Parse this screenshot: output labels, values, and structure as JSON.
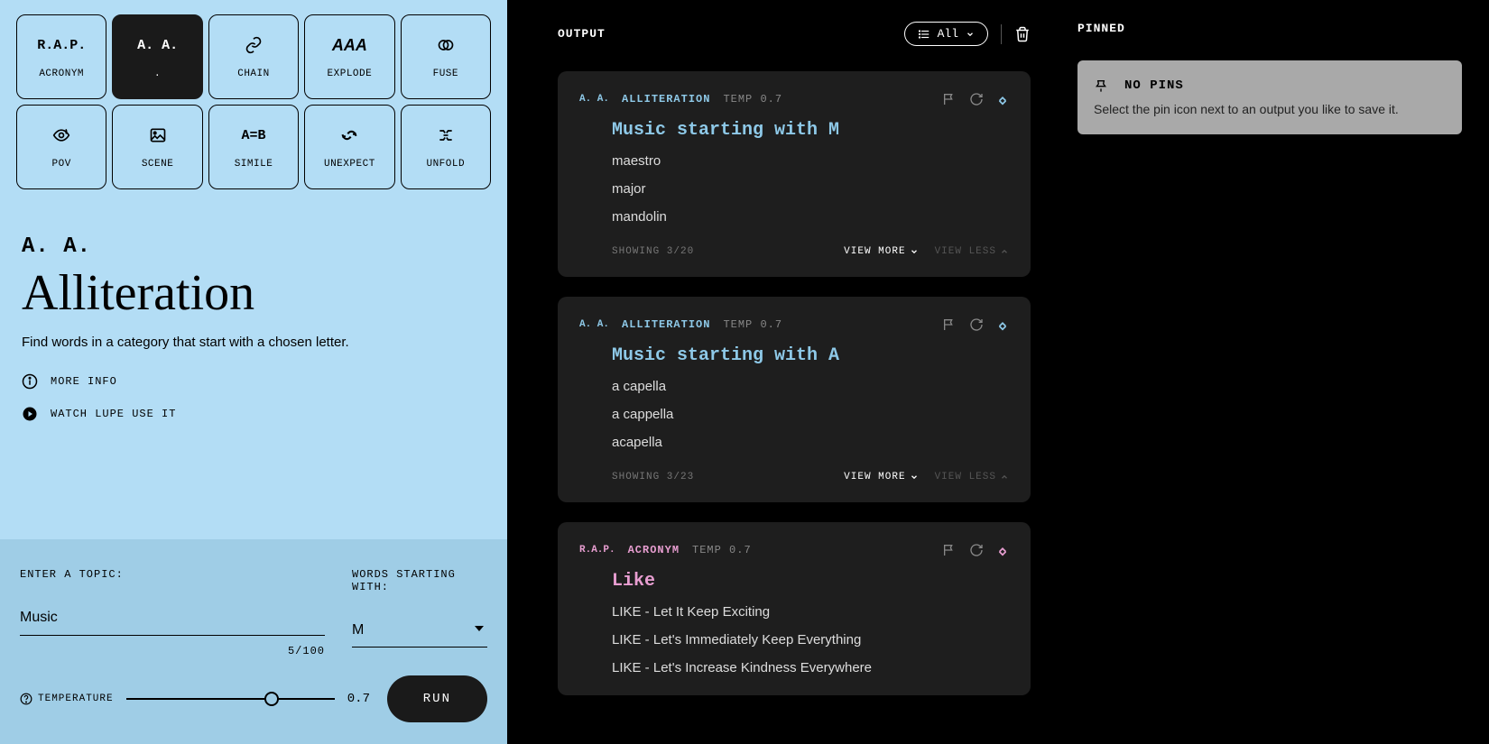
{
  "tools": [
    {
      "id": "acronym",
      "label": "ACRONYM",
      "icon": "R.A.P."
    },
    {
      "id": "alliteration",
      "label": ".",
      "icon": "A. A."
    },
    {
      "id": "chain",
      "label": "CHAIN",
      "icon": "chain"
    },
    {
      "id": "explode",
      "label": "EXPLODE",
      "icon": "explode"
    },
    {
      "id": "fuse",
      "label": "FUSE",
      "icon": "fuse"
    },
    {
      "id": "pov",
      "label": "POV",
      "icon": "pov"
    },
    {
      "id": "scene",
      "label": "SCENE",
      "icon": "scene"
    },
    {
      "id": "simile",
      "label": "SIMILE",
      "icon": "A=B"
    },
    {
      "id": "unexpect",
      "label": "UNEXPECT",
      "icon": "unexpect"
    },
    {
      "id": "unfold",
      "label": "UNFOLD",
      "icon": "unfold"
    }
  ],
  "active_tool": "alliteration",
  "hero": {
    "icon": "A. A.",
    "title": "Alliteration",
    "desc": "Find words in a category that start with a chosen letter.",
    "more_info": "MORE INFO",
    "watch": "WATCH LUPE USE IT"
  },
  "controls": {
    "topic_label": "ENTER A TOPIC:",
    "topic_value": "Music",
    "letter_label": "WORDS STARTING WITH:",
    "letter_value": "M",
    "charcount": "5/100",
    "temp_label": "TEMPERATURE",
    "temp_value": "0.7",
    "temp_pct": 70,
    "run": "RUN"
  },
  "output": {
    "title": "OUTPUT",
    "filter": "All",
    "cards": [
      {
        "icon": "A. A.",
        "tool": "ALLITERATION",
        "temp": "TEMP 0.7",
        "title": "Music starting with M",
        "items": [
          "maestro",
          "major",
          "mandolin"
        ],
        "showing": "SHOWING 3/20",
        "view_more": "VIEW MORE",
        "view_less": "VIEW LESS",
        "color": "blue"
      },
      {
        "icon": "A. A.",
        "tool": "ALLITERATION",
        "temp": "TEMP 0.7",
        "title": "Music starting with A",
        "items": [
          "a capella",
          "a cappella",
          "acapella"
        ],
        "showing": "SHOWING 3/23",
        "view_more": "VIEW MORE",
        "view_less": "VIEW LESS",
        "color": "blue"
      },
      {
        "icon": "R.A.P.",
        "tool": "ACRONYM",
        "temp": "TEMP 0.7",
        "title": "Like",
        "items": [
          "LIKE - Let It Keep Exciting",
          "LIKE - Let's Immediately Keep Everything",
          "LIKE - Let's Increase Kindness Everywhere"
        ],
        "color": "pink"
      }
    ]
  },
  "pinned": {
    "title": "PINNED",
    "empty_title": "NO PINS",
    "empty_desc": "Select the pin icon next to an output you like to save it."
  }
}
